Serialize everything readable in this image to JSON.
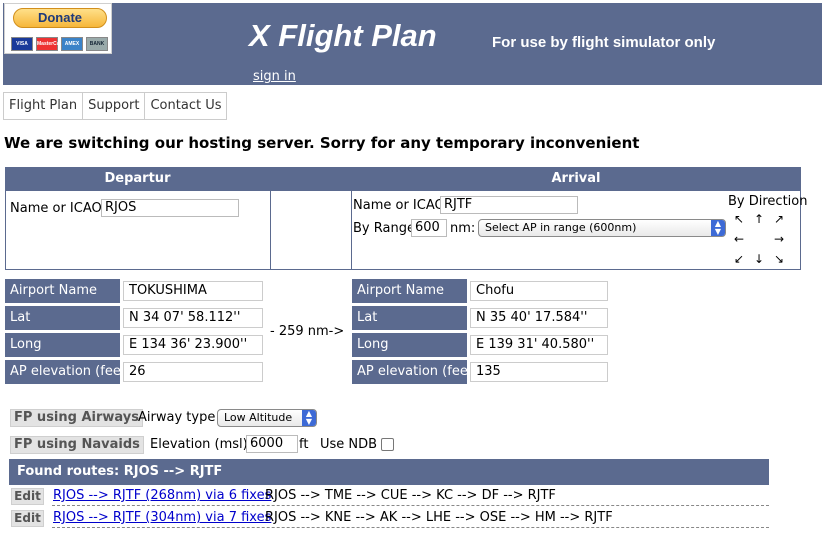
{
  "header": {
    "donate_label": "Donate",
    "cards": [
      "VISA",
      "MasterCard",
      "AMEX",
      "BANK"
    ],
    "title": "X Flight Plan",
    "subtitle": "For use by flight simulator only",
    "sign_in": "sign in",
    "colors": {
      "bar": "#5b6a8f",
      "donate": "#f6b63a"
    }
  },
  "nav": {
    "items": [
      "Flight Plan",
      "Support",
      "Contact Us"
    ]
  },
  "notice": "We are switching our hosting server. Sorry for any temporary inconvenient",
  "departure": {
    "header": "Departur",
    "name_label": "Name or ICAO",
    "icao": "RJOS"
  },
  "arrival": {
    "header": "Arrival",
    "name_label": "Name or ICAO",
    "icao": "RJTF",
    "range_label": "By Range",
    "range_value": "600",
    "range_unit": "nm:",
    "range_select": "Select AP in range (600nm)",
    "direction_label": "By Direction",
    "direction_icons": [
      "arrow-nw-icon",
      "arrow-n-icon",
      "arrow-ne-icon",
      "arrow-w-icon",
      "arrow-e-icon",
      "arrow-sw-icon",
      "arrow-s-icon",
      "arrow-se-icon"
    ]
  },
  "info": {
    "labels": [
      "Airport Name",
      "Lat",
      "Long",
      "AP elevation (feet)"
    ],
    "departure_values": [
      "TOKUSHIMA",
      "N 34 07' 58.112''",
      "E 134 36' 23.900''",
      "26"
    ],
    "arrival_values": [
      "Chofu",
      "N 35 40' 17.584''",
      "E 139 31' 40.580''",
      "135"
    ],
    "distance": "- 259 nm->"
  },
  "fp": {
    "airways_button": "FP using Airways",
    "airway_type_label": "Airway type",
    "airway_type_value": "Low Altitude",
    "navaids_button": "FP using Navaids",
    "elevation_label": "Elevation (msl)",
    "elevation_value": "6000",
    "elevation_unit": "ft",
    "ndb_label": "Use NDB",
    "ndb_checked": false
  },
  "routes": {
    "header": "Found routes: RJOS --> RJTF",
    "items": [
      {
        "edit": "Edit",
        "link": "RJOS --> RJTF (268nm) via 6 fixes",
        "path": "RJOS --> TME --> CUE --> KC --> DF --> RJTF"
      },
      {
        "edit": "Edit",
        "link": "RJOS --> RJTF (304nm) via 7 fixes",
        "path": "RJOS --> KNE --> AK --> LHE --> OSE --> HM --> RJTF"
      }
    ]
  }
}
